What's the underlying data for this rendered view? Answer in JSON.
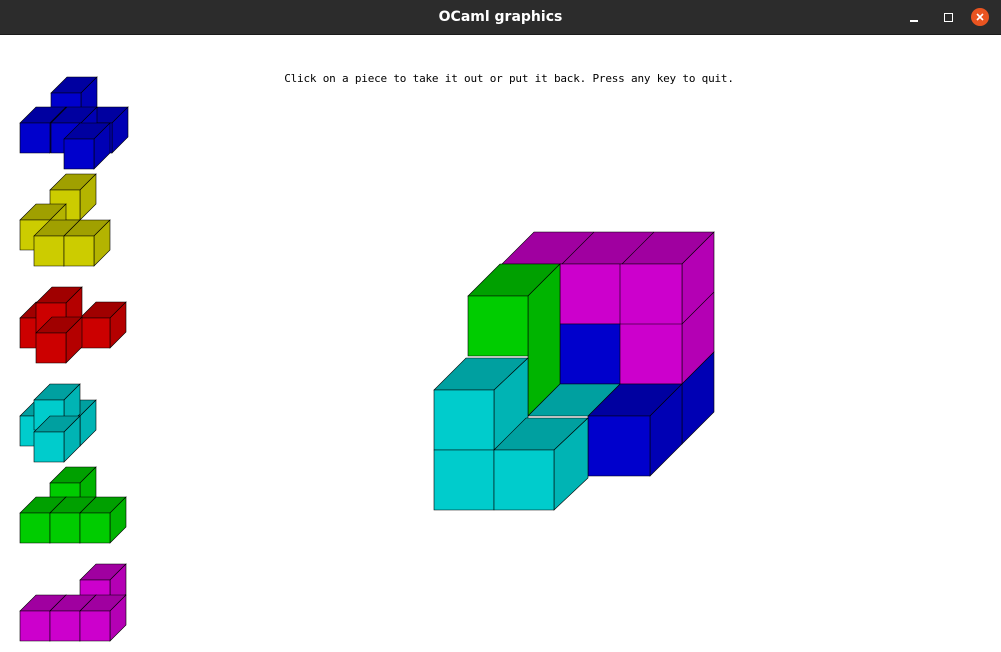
{
  "window": {
    "title": "OCaml graphics",
    "controls": [
      "minimize",
      "maximize",
      "close"
    ],
    "close_color": "#e95420"
  },
  "instructions": "Click on a piece to take it out or put it back. Press any key to quit.",
  "pieces": [
    {
      "name": "blue",
      "color": "#0000cc",
      "shade": "#0000a0",
      "side": "#0000b4"
    },
    {
      "name": "yellow",
      "color": "#cccc00",
      "shade": "#a0a000",
      "side": "#b4b400"
    },
    {
      "name": "red",
      "color": "#cc0000",
      "shade": "#a00000",
      "side": "#b40000"
    },
    {
      "name": "cyan",
      "color": "#00cccc",
      "shade": "#00a0a0",
      "side": "#00b4b4"
    },
    {
      "name": "green",
      "color": "#00cc00",
      "shade": "#00a000",
      "side": "#00b400"
    },
    {
      "name": "magenta",
      "color": "#cc00cc",
      "shade": "#a000a0",
      "side": "#b400b4"
    }
  ],
  "puzzle": {
    "description_hidden": true
  }
}
